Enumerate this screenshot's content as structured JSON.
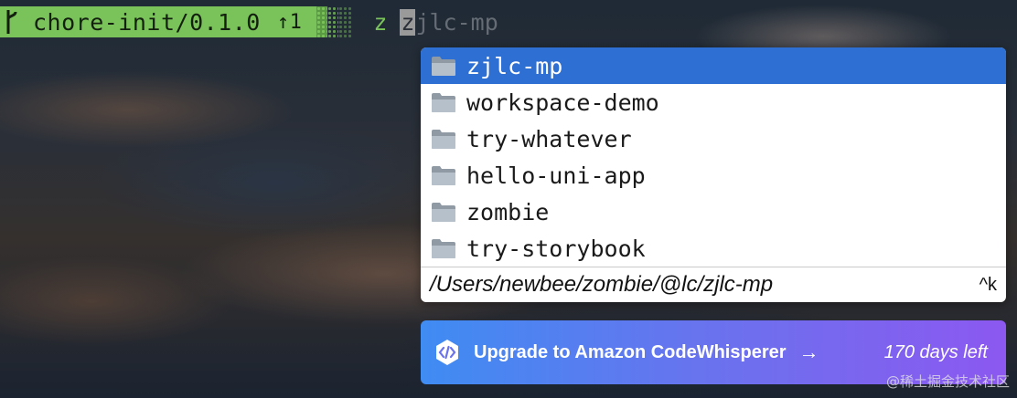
{
  "prompt": {
    "branch": "chore-init/0.1.0",
    "ahead": "↑1",
    "command": "z",
    "typed_cursor_char": "z",
    "ghost_suggestion": "jlc-mp"
  },
  "completion": {
    "items": [
      {
        "label": "zjlc-mp",
        "icon": "folder-icon",
        "selected": true
      },
      {
        "label": "workspace-demo",
        "icon": "folder-icon"
      },
      {
        "label": "try-whatever",
        "icon": "folder-icon"
      },
      {
        "label": "hello-uni-app",
        "icon": "folder-icon"
      },
      {
        "label": "zombie",
        "icon": "folder-icon"
      },
      {
        "label": "try-storybook",
        "icon": "folder-icon"
      }
    ],
    "path": "/Users/newbee/zombie/@lc/zjlc-mp",
    "shortcut": "^k"
  },
  "banner": {
    "icon": "codewhisperer-icon",
    "label": "Upgrade to Amazon CodeWhisperer",
    "arrow": "→",
    "days_left": "170 days left"
  },
  "watermark": "@稀土掘金技术社区",
  "colors": {
    "prompt_green": "#7ac35a",
    "selection_blue": "#2e6fd3",
    "banner_start": "#3f8cf3",
    "banner_end": "#8c58f0"
  }
}
